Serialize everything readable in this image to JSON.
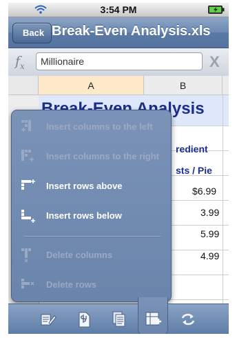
{
  "status_bar": {
    "time": "3:54 PM"
  },
  "nav": {
    "back_label": "Back",
    "title": "Break-Even Analysis.xls"
  },
  "formula": {
    "fx_symbol": "f",
    "fx_sub": "x",
    "value": "Millionaire",
    "close_glyph": "X"
  },
  "sheet": {
    "columns": [
      "A",
      "B"
    ],
    "title": "Break-Even Analysis",
    "header_b_line1": "redient",
    "header_b_line2": "sts / Pie",
    "values": [
      "$6.99",
      "3.99",
      "5.99",
      "4.99"
    ]
  },
  "menu": {
    "items": [
      {
        "label": "Insert columns to the left",
        "enabled": false,
        "icon": "insert-column-left-icon"
      },
      {
        "label": "Insert columns to the right",
        "enabled": false,
        "icon": "insert-column-right-icon"
      },
      {
        "label": "Insert rows above",
        "enabled": true,
        "icon": "insert-row-above-icon"
      },
      {
        "label": "Insert rows below",
        "enabled": true,
        "icon": "insert-row-below-icon"
      },
      {
        "label": "Delete columns",
        "enabled": false,
        "icon": "delete-column-icon"
      },
      {
        "label": "Delete rows",
        "enabled": false,
        "icon": "delete-row-icon"
      }
    ]
  },
  "toolbar": {
    "buttons": [
      "edit-icon",
      "currency-format-icon",
      "sheets-icon",
      "insert-icon",
      "refresh-icon"
    ]
  },
  "colors": {
    "accent": "#1a2e8c",
    "nav": "#6b89b3",
    "menu": "#7089ae"
  }
}
